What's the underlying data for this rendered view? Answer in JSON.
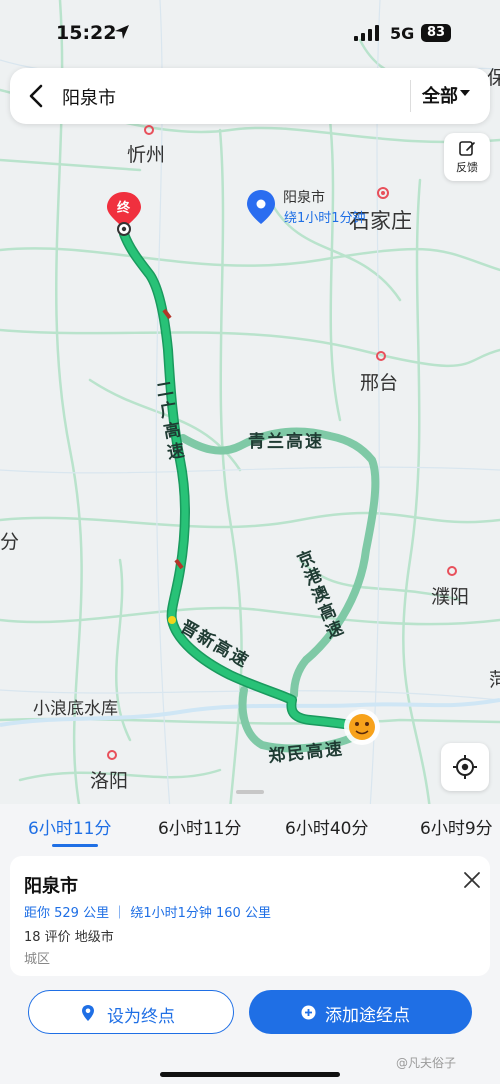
{
  "status_bar": {
    "time": "15:22",
    "network": "5G",
    "battery": "83"
  },
  "search": {
    "query": "阳泉市",
    "filter": "全部"
  },
  "feedback": {
    "label": "反馈"
  },
  "map": {
    "cities": [
      "忻州",
      "石家庄",
      "邢台",
      "濮阳",
      "洛阳",
      "小浪底水库"
    ],
    "poi_title": "阳泉市",
    "poi_subtitle": "绕1小时1分钟",
    "end_marker": "终",
    "roads": [
      "二广高速",
      "青兰高速",
      "京港澳高速",
      "晋新高速",
      "郑民高速"
    ],
    "edge_labels": {
      "left": "分",
      "right_top": "保",
      "right_mid": "菏"
    }
  },
  "tabs": [
    {
      "label": "6小时11分",
      "active": true
    },
    {
      "label": "6小时11分",
      "active": false
    },
    {
      "label": "6小时40分",
      "active": false
    },
    {
      "label": "6小时9分",
      "active": false
    }
  ],
  "place": {
    "name": "阳泉市",
    "distance": "距你 529 公里 ｜ 绕1小时1分钟 160 公里",
    "rating": "18 评价  地级市",
    "category": "城区"
  },
  "actions": {
    "set_destination": "设为终点",
    "add_waypoint": "添加途经点"
  },
  "watermark": "@凡夫俗子",
  "colors": {
    "accent": "#1f6fe5",
    "route": "#1fb26b",
    "alt_route": "#7fc9a6",
    "end_marker": "#f0303e"
  }
}
